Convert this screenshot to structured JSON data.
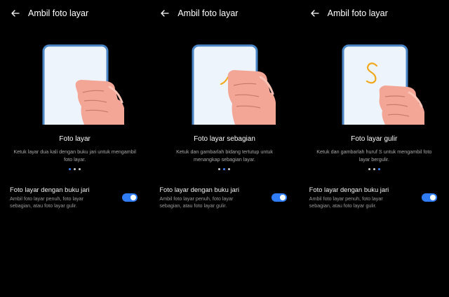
{
  "colors": {
    "accent": "#2f7cf6",
    "background": "#000000",
    "card_border": "#4a86c6",
    "skin": "#f3a596",
    "gesture_stroke": "#f0a81c"
  },
  "screens": [
    {
      "header_title": "Ambil foto layar",
      "back_icon": "arrow-left-icon",
      "card_title": "Foto layar",
      "card_desc": "Ketuk layar dua kali dengan buku jari untuk mengambil foto layar.",
      "pager_active": 0,
      "setting_title": "Foto layar dengan buku jari",
      "setting_desc": "Ambil foto layar penuh, foto layar sebagian, atau foto layar gulir.",
      "toggle_on": true
    },
    {
      "header_title": "Ambil foto layar",
      "back_icon": "arrow-left-icon",
      "card_title": "Foto layar sebagian",
      "card_desc": "Ketuk dan gambarlah bidang tertutup untuk menangkap sebagian layar.",
      "pager_active": 1,
      "setting_title": "Foto layar dengan buku jari",
      "setting_desc": "Ambil foto layar penuh, foto layar sebagian, atau foto layar gulir.",
      "toggle_on": true
    },
    {
      "header_title": "Ambil foto layar",
      "back_icon": "arrow-left-icon",
      "card_title": "Foto layar gulir",
      "card_desc": "Ketuk dan gambarlah huruf S untuk mengambil foto layar bergulir.",
      "pager_active": 2,
      "setting_title": "Foto layar dengan buku jari",
      "setting_desc": "Ambil foto layar penuh, foto layar sebagian, atau foto layar gulir.",
      "toggle_on": true
    }
  ]
}
